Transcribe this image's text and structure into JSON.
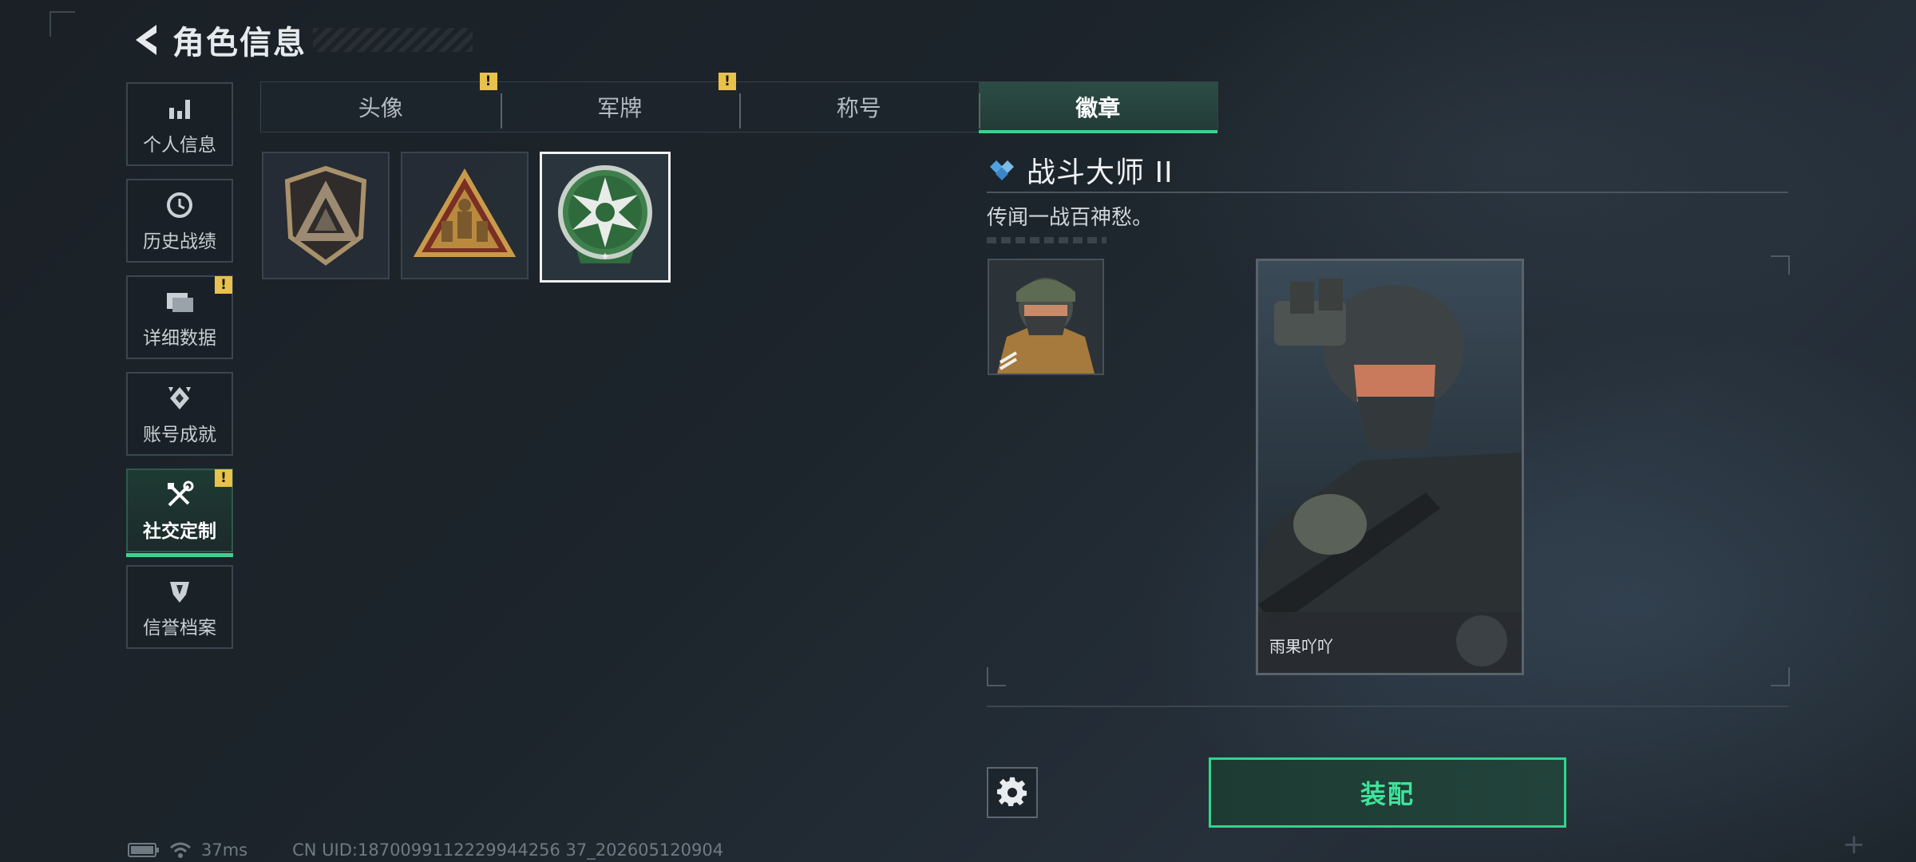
{
  "header": {
    "title": "角色信息"
  },
  "side_nav": [
    {
      "label": "个人信息",
      "icon": "bar-chart-icon",
      "alert": false,
      "active": false
    },
    {
      "label": "历史战绩",
      "icon": "history-icon",
      "alert": false,
      "active": false
    },
    {
      "label": "详细数据",
      "icon": "folders-icon",
      "alert": true,
      "active": false
    },
    {
      "label": "账号成就",
      "icon": "achievement-icon",
      "alert": false,
      "active": false
    },
    {
      "label": "社交定制",
      "icon": "tools-icon",
      "alert": true,
      "active": true
    },
    {
      "label": "信誉档案",
      "icon": "credit-icon",
      "alert": false,
      "active": false
    }
  ],
  "tabs": [
    {
      "label": "头像",
      "alert": true,
      "active": false
    },
    {
      "label": "军牌",
      "alert": true,
      "active": false
    },
    {
      "label": "称号",
      "alert": false,
      "active": false
    },
    {
      "label": "徽章",
      "alert": false,
      "active": true
    }
  ],
  "alert_mark": "!",
  "badges": [
    {
      "name": "shield-triangle-badge",
      "selected": false
    },
    {
      "name": "soldiers-triangle-badge",
      "selected": false
    },
    {
      "name": "green-star-badge",
      "selected": true
    }
  ],
  "detail": {
    "title": "战斗大师 II",
    "description": "传闻一战百神愁。"
  },
  "card": {
    "player_name": "雨果吖吖"
  },
  "equip_button": {
    "label": "装配"
  },
  "status": {
    "ping": "37ms",
    "uid": "CN UID:1870099112229944256 37_202605120904"
  },
  "colors": {
    "accent": "#3fd08f",
    "alert": "#e8c24a",
    "diamond": "#4fa3e0"
  }
}
